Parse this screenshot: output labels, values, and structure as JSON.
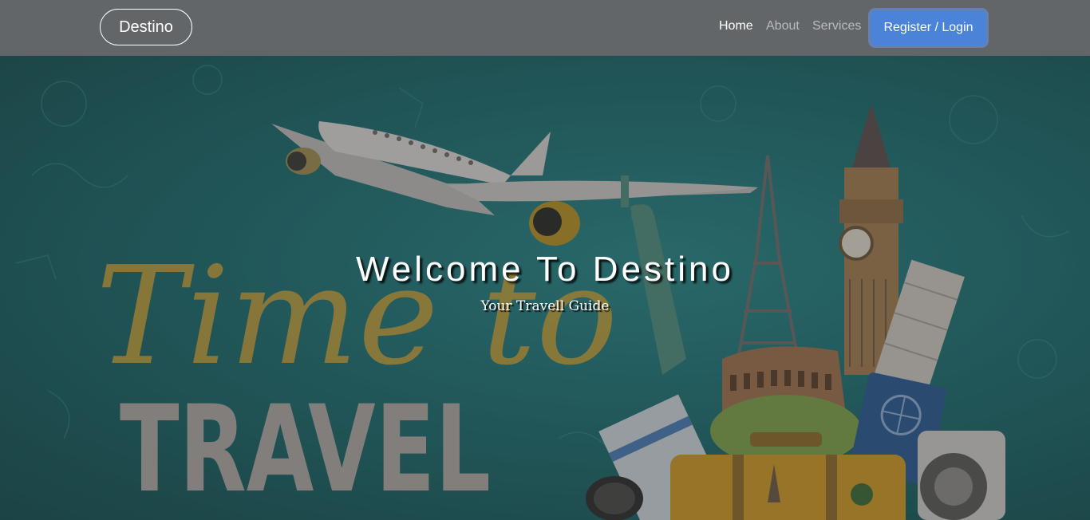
{
  "navbar": {
    "brand": "Destino",
    "links": [
      {
        "label": "Home",
        "active": true
      },
      {
        "label": "About",
        "active": false
      },
      {
        "label": "Services",
        "active": false
      }
    ],
    "cta_label": "Register / Login"
  },
  "hero": {
    "title": "Welcome To Destino",
    "subtitle": "Your Travell Guide",
    "background_text": {
      "script": "Time to",
      "block": "TRAVEL"
    }
  },
  "colors": {
    "navbar_bg": "#636669",
    "cta_bg": "#4b83d8",
    "hero_teal": "#1f6c6f",
    "script_yellow": "#c9a23a"
  },
  "icons": [
    "airplane-icon",
    "big-ben-icon",
    "eiffel-tower-icon",
    "statue-of-liberty-icon",
    "colosseum-icon",
    "leaning-tower-icon",
    "passport-icon",
    "camera-icon",
    "suitcase-icon",
    "sunglasses-icon",
    "globe-icon"
  ]
}
